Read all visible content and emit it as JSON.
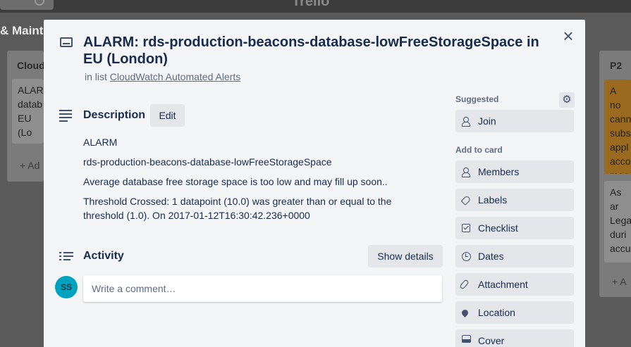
{
  "app": {
    "logo": "Trello"
  },
  "board": {
    "title": "& Mainte",
    "lists": [
      {
        "name": "Cloud",
        "cards": [
          {
            "text": "ALARI\ndatab\nEU (Lo"
          }
        ],
        "add_label": "+ Ad"
      },
      {
        "name": "P2",
        "cards": [
          {
            "text": "A no\ncann\nsubs\nappl\nacco\nmea"
          },
          {
            "text": "As ar\nLega\nduri\naccu"
          }
        ],
        "add_label": "+ A"
      }
    ]
  },
  "card": {
    "title": "ALARM: rds-production-beacons-database-lowFreeStorageSpace in EU (London)",
    "in_list_prefix": "in list",
    "list_name": "CloudWatch Automated Alerts",
    "close_icon": "close-icon"
  },
  "description": {
    "heading": "Description",
    "edit_label": "Edit",
    "lines": [
      "ALARM",
      "rds-production-beacons-database-lowFreeStorageSpace",
      "Average database free storage space is too low and may fill up soon..",
      "Threshold Crossed: 1 datapoint (10.0) was greater than or equal to the threshold (1.0). On 2017-01-12T16:30:42.236+0000"
    ]
  },
  "activity": {
    "heading": "Activity",
    "show_details_label": "Show details",
    "avatar_initials": "SS",
    "comment_placeholder": "Write a comment…"
  },
  "sidebar": {
    "suggested_label": "Suggested",
    "join_label": "Join",
    "add_to_card_label": "Add to card",
    "items": [
      {
        "label": "Members",
        "icon": "person-icon"
      },
      {
        "label": "Labels",
        "icon": "tag-icon"
      },
      {
        "label": "Checklist",
        "icon": "checklist-icon"
      },
      {
        "label": "Dates",
        "icon": "clock-icon"
      },
      {
        "label": "Attachment",
        "icon": "paperclip-icon"
      },
      {
        "label": "Location",
        "icon": "location-pin-icon"
      },
      {
        "label": "Cover",
        "icon": "cover-icon"
      }
    ]
  },
  "colors": {
    "modal_bg": "#f4f5f7",
    "button_bg": "#e4e6ea",
    "text_primary": "#172b4d",
    "text_secondary": "#5e6c84",
    "avatar_bg": "#00a3bf",
    "card_orange": "#9a6a1f"
  }
}
